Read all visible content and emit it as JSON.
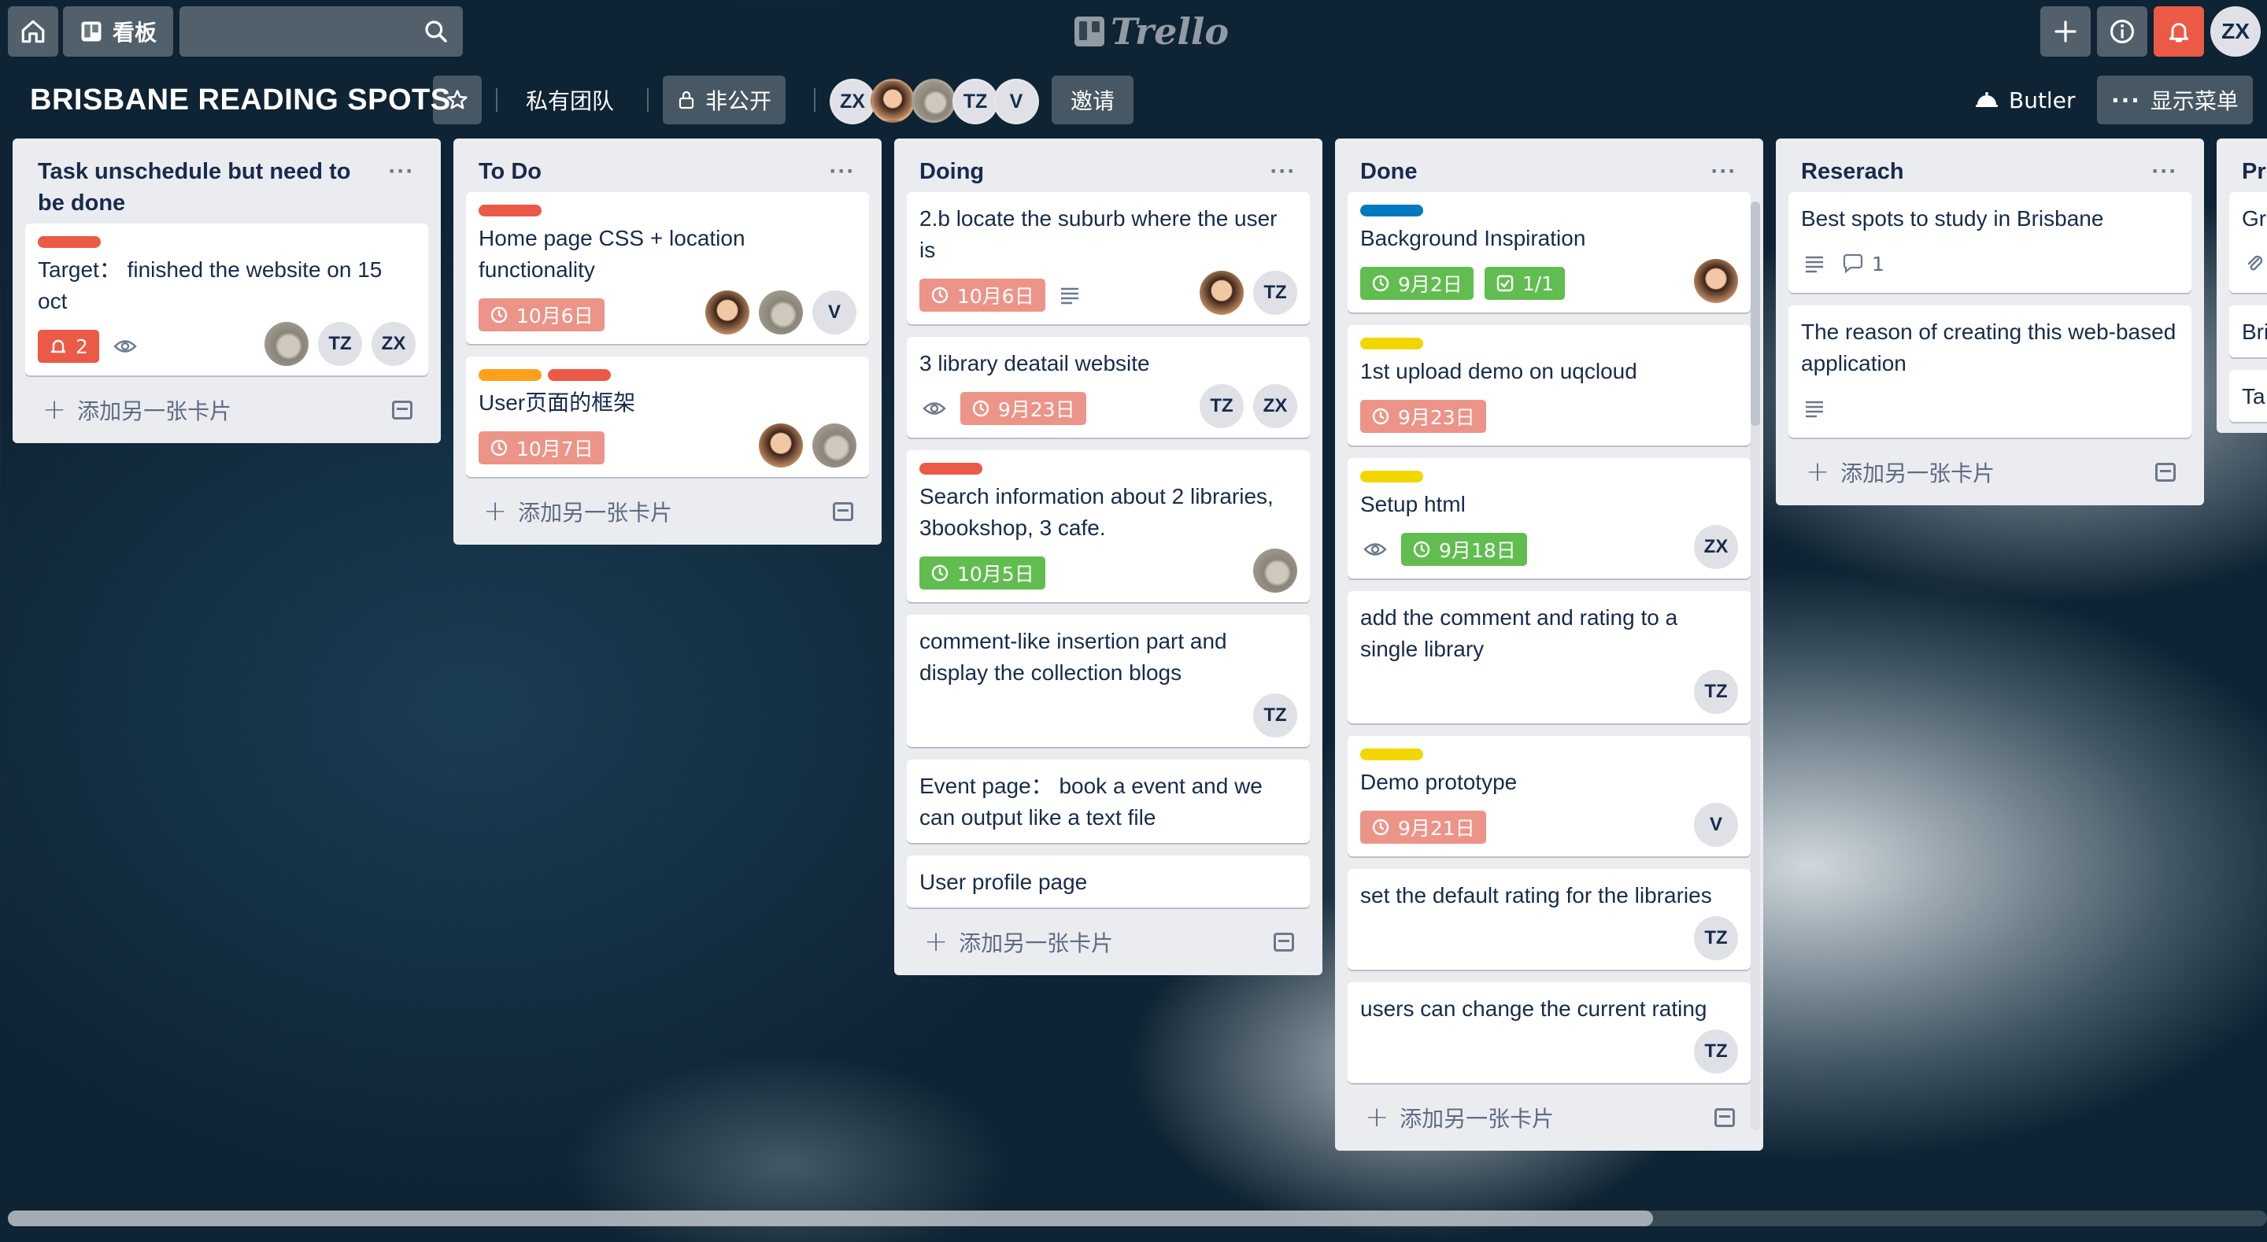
{
  "colors": {
    "label_red": "#eb5a46",
    "label_orange": "#ff9f1a",
    "label_blue": "#0079bf",
    "label_yellow": "#f2d600",
    "due_red": "#ec9488",
    "due_green": "#61bd4f",
    "notify_red": "#eb5a46",
    "notification_button": "#eb5a46"
  },
  "topbar": {
    "home_icon": "home-icon",
    "boards_label": "看板",
    "search_placeholder": "",
    "logo_text": "Trello",
    "add_icon": "plus-icon",
    "info_icon": "info-icon",
    "notification_icon": "bell-icon",
    "user_initials": "ZX"
  },
  "board": {
    "title": "BRISBANE READING SPOTS",
    "star_icon": "star-icon",
    "team_label": "私有团队",
    "visibility_label": "非公开",
    "members": [
      "ZX",
      "",
      "",
      "TZ",
      "V"
    ],
    "invite_label": "邀请",
    "butler_label": "Butler",
    "menu_label": "显示菜单"
  },
  "add_card_label": "添加另一张卡片",
  "lists": [
    {
      "title": "Task unschedule but need to be done",
      "cards": [
        {
          "labels": [
            "red"
          ],
          "title": "Target： finished the website on 15 oct",
          "badges": [
            {
              "type": "notify",
              "text": "2"
            },
            {
              "type": "watch",
              "text": ""
            }
          ],
          "members": [
            "photo-bird",
            "TZ",
            "ZX"
          ]
        }
      ]
    },
    {
      "title": "To Do",
      "cards": [
        {
          "labels": [
            "red"
          ],
          "title": "Home page CSS + location functionality",
          "badges": [
            {
              "type": "due-red",
              "text": "10月6日"
            }
          ],
          "members": [
            "photo-girl",
            "photo-bird",
            "V"
          ]
        },
        {
          "labels": [
            "orange",
            "red"
          ],
          "title": "User页面的框架",
          "badges": [
            {
              "type": "due-red",
              "text": "10月7日"
            }
          ],
          "members": [
            "photo-girl",
            "photo-bird"
          ]
        }
      ]
    },
    {
      "title": "Doing",
      "cards": [
        {
          "labels": [],
          "title": "2.b locate the suburb where the user is",
          "badges": [
            {
              "type": "due-red",
              "text": "10月6日"
            },
            {
              "type": "desc",
              "text": ""
            }
          ],
          "members": [
            "photo-girl",
            "TZ"
          ]
        },
        {
          "labels": [],
          "title": "3 library deatail website",
          "badges": [
            {
              "type": "watch",
              "text": ""
            },
            {
              "type": "due-red",
              "text": "9月23日"
            }
          ],
          "members": [
            "TZ",
            "ZX"
          ]
        },
        {
          "labels": [
            "red"
          ],
          "title": "Search information about 2 libraries, 3bookshop, 3 cafe.",
          "badges": [
            {
              "type": "due-green",
              "text": "10月5日"
            }
          ],
          "members": [
            "photo-bird"
          ]
        },
        {
          "labels": [],
          "title": "comment-like insertion part and display the collection blogs",
          "badges": [],
          "members": [
            "TZ"
          ]
        },
        {
          "labels": [],
          "title": "Event page： book a event and we can output like a text file",
          "badges": [],
          "members": []
        },
        {
          "labels": [],
          "title": "User profile page",
          "badges": [],
          "members": []
        }
      ]
    },
    {
      "title": "Done",
      "cards": [
        {
          "labels": [
            "blue"
          ],
          "title": "Background Inspiration",
          "badges": [
            {
              "type": "due-green",
              "text": "9月2日"
            },
            {
              "type": "check-green",
              "text": "1/1"
            }
          ],
          "members": [
            "photo-girl"
          ]
        },
        {
          "labels": [
            "yellow"
          ],
          "title": "1st upload demo on uqcloud",
          "badges": [
            {
              "type": "due-red",
              "text": "9月23日"
            }
          ],
          "members": []
        },
        {
          "labels": [
            "yellow"
          ],
          "title": "Setup html",
          "badges": [
            {
              "type": "watch",
              "text": ""
            },
            {
              "type": "due-green",
              "text": "9月18日"
            }
          ],
          "members": [
            "ZX"
          ]
        },
        {
          "labels": [],
          "title": "add the comment and rating to a single library",
          "badges": [],
          "members": [
            "TZ"
          ]
        },
        {
          "labels": [
            "yellow"
          ],
          "title": "Demo prototype",
          "badges": [
            {
              "type": "due-red",
              "text": "9月21日"
            }
          ],
          "members": [
            "V"
          ]
        },
        {
          "labels": [],
          "title": "set the default rating for the libraries",
          "badges": [],
          "members": [
            "TZ"
          ]
        },
        {
          "labels": [],
          "title": "users can change the current rating",
          "badges": [],
          "members": [
            "TZ"
          ]
        }
      ]
    },
    {
      "title": "Reserach",
      "cards": [
        {
          "labels": [],
          "title": "Best spots to study in Brisbane",
          "badges": [
            {
              "type": "desc",
              "text": ""
            },
            {
              "type": "comment",
              "text": "1"
            }
          ],
          "members": []
        },
        {
          "labels": [],
          "title": "The reason of creating this web-based application",
          "badges": [
            {
              "type": "desc",
              "text": ""
            }
          ],
          "members": []
        }
      ]
    },
    {
      "title": "Pr",
      "cards": [
        {
          "labels": [],
          "title": "Gr",
          "badges": [
            {
              "type": "attach",
              "text": ""
            }
          ],
          "members": []
        },
        {
          "labels": [],
          "title": "Bri",
          "badges": [],
          "members": []
        },
        {
          "labels": [],
          "title": "Ta",
          "badges": [],
          "members": []
        }
      ]
    }
  ]
}
